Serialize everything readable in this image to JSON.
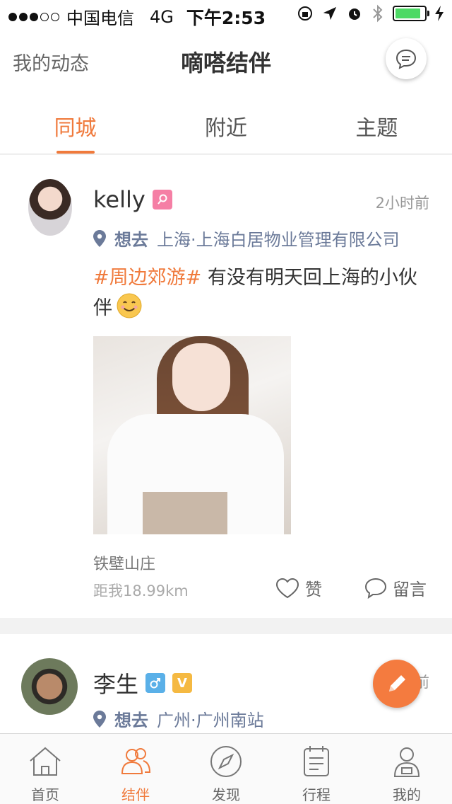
{
  "status_bar": {
    "carrier": "中国电信",
    "network": "4G",
    "time": "下午2:53",
    "battery_color": "#4cd964"
  },
  "header": {
    "left_label": "我的动态",
    "title": "嘀嗒结伴",
    "message_icon": "chat-bubble-icon"
  },
  "tabs": [
    {
      "label": "同城",
      "active": true
    },
    {
      "label": "附近",
      "active": false
    },
    {
      "label": "主题",
      "active": false
    }
  ],
  "posts": [
    {
      "username": "kelly",
      "gender_badge_color": "#f57fa5",
      "time_ago": "2小时前",
      "want_label": "想去",
      "destination": "上海·上海白居物业管理有限公司",
      "topic": "#周边郊游#",
      "text": " 有没有明天回上海的小伙伴",
      "place_name": "铁壁山庄",
      "distance": "距我18.99km",
      "like_label": "赞",
      "comment_label": "留言"
    },
    {
      "username": "李生",
      "gender_badge_color": "#5ab0e8",
      "vip_badge": "V",
      "vip_badge_color": "#f5b942",
      "time_ago_partial": "前",
      "want_label": "想去",
      "destination": "广州·广州南站"
    }
  ],
  "accent_color": "#f07a3c",
  "bottom_nav": [
    {
      "label": "首页",
      "icon": "home-icon",
      "active": false
    },
    {
      "label": "结伴",
      "icon": "group-icon",
      "active": true
    },
    {
      "label": "发现",
      "icon": "compass-icon",
      "active": false
    },
    {
      "label": "行程",
      "icon": "itinerary-icon",
      "active": false
    },
    {
      "label": "我的",
      "icon": "profile-icon",
      "active": false
    }
  ]
}
